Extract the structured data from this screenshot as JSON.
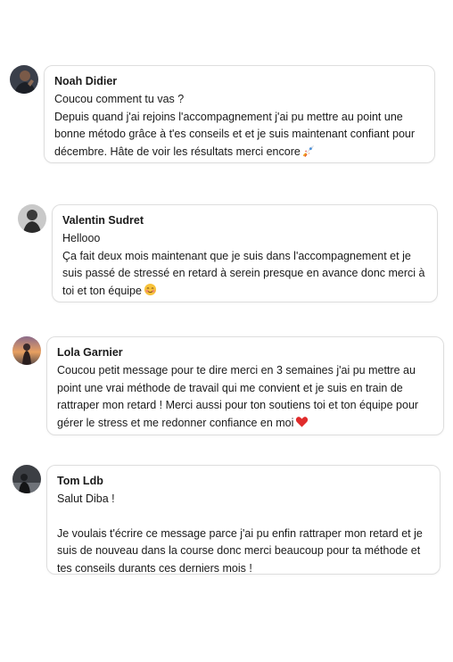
{
  "messages": [
    {
      "author": "Noah Didier",
      "lines": [
        "Coucou comment tu vas ?",
        "Depuis quand j'ai rejoins l'accompagnement j'ai pu mettre au point une",
        "bonne método grâce à t'es conseils et et je suis maintenant confiant pour",
        "décembre. Hâte de voir les résultats merci encore"
      ],
      "emoji": "rocket-emoji"
    },
    {
      "author": "Valentin Sudret",
      "lines": [
        "Hellooo",
        "Ça fait deux mois maintenant que je suis dans l'accompagnement et je",
        "suis passé de stressé en retard à serein presque en avance donc merci à",
        "toi et ton équipe"
      ],
      "emoji": "smiling-face-emoji"
    },
    {
      "author": "Lola Garnier",
      "lines": [
        "Coucou petit message pour te dire merci en 3 semaines j'ai pu mettre au",
        "point une vrai méthode de travail qui me convient et je suis en train de",
        "rattraper mon retard ! Merci aussi pour ton soutiens toi et ton équipe pour",
        "gérer le stress et me redonner confiance en moi"
      ],
      "emoji": "red-heart-emoji"
    },
    {
      "author": "Tom Ldb",
      "lines": [
        "Salut Diba !",
        "",
        "Je voulais t'écrire ce message parce j'ai pu enfin rattraper mon retard et je",
        "suis de nouveau dans la course donc merci beaucoup pour ta méthode et",
        "tes conseils durants ces derniers mois !"
      ],
      "emoji": ""
    }
  ]
}
